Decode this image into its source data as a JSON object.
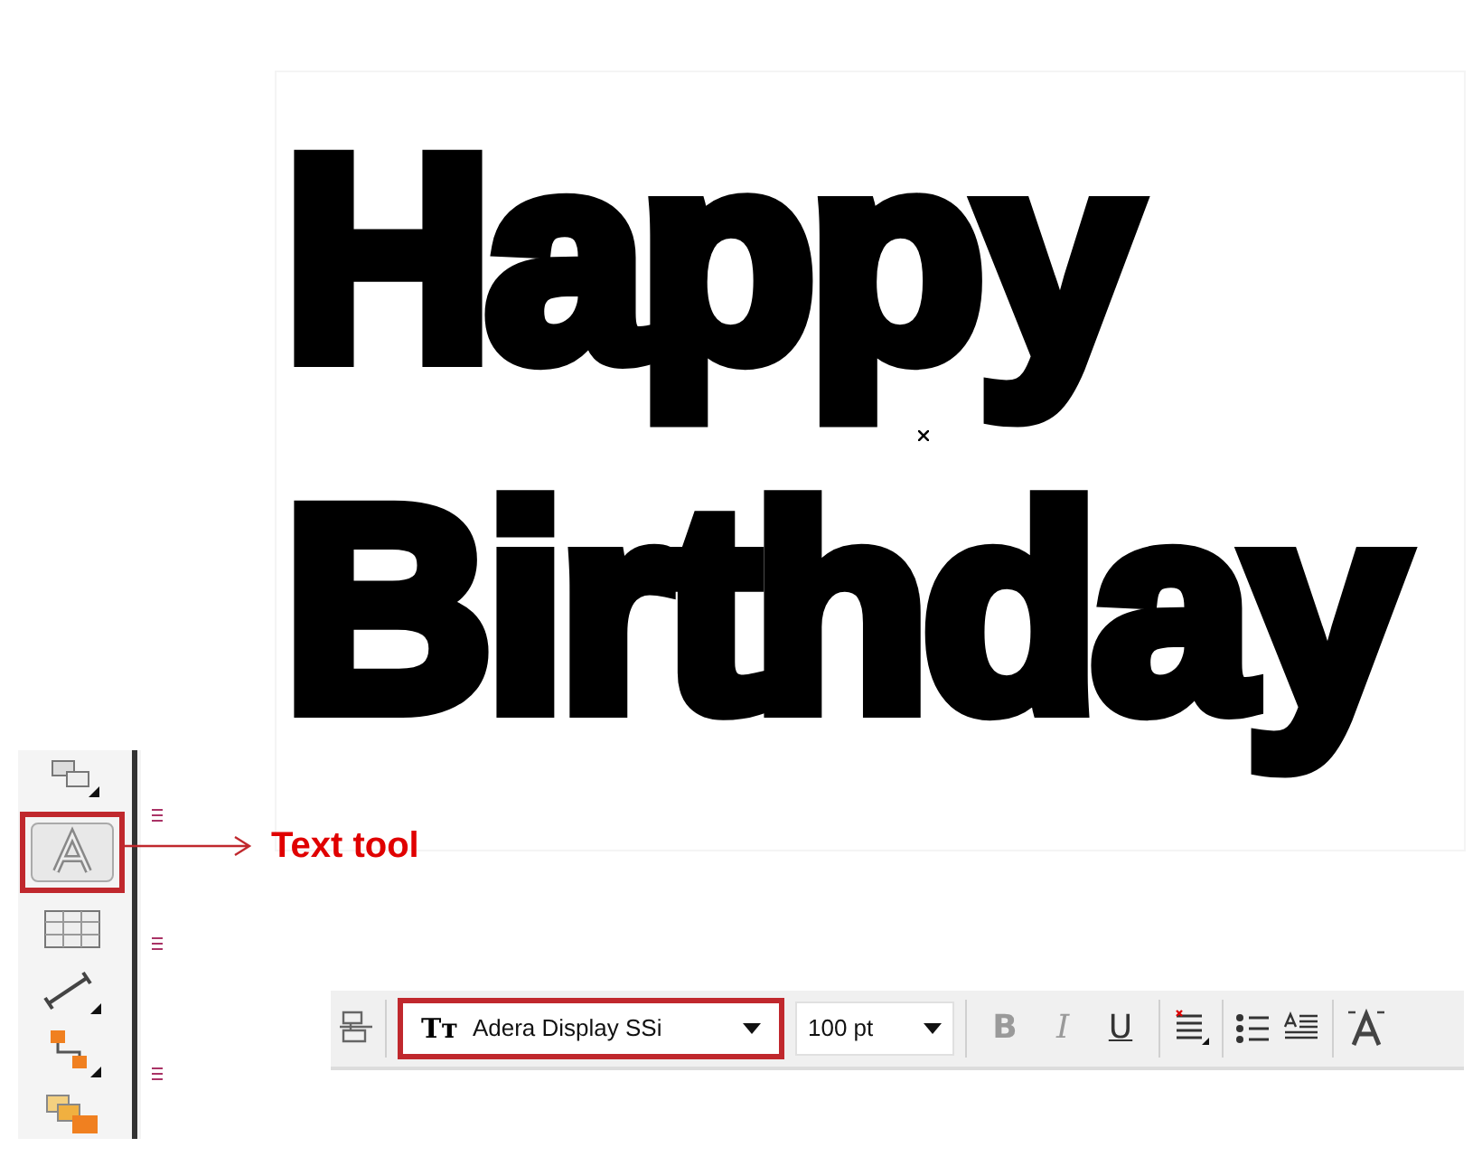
{
  "canvas": {
    "lines": [
      "Happy",
      "Birthday"
    ]
  },
  "toolbox": {
    "tools": [
      {
        "kind": "shapes",
        "selected": false
      },
      {
        "kind": "text",
        "selected": true
      },
      {
        "kind": "table",
        "selected": false
      },
      {
        "kind": "dimension",
        "selected": false
      },
      {
        "kind": "connector",
        "selected": false
      },
      {
        "kind": "blend",
        "selected": false
      }
    ]
  },
  "callout": {
    "label": "Text tool"
  },
  "property_bar": {
    "font": {
      "type_icon": "Tт",
      "value": "Adera Display SSi",
      "highlighted": true
    },
    "size": {
      "value": "100 pt"
    },
    "format_buttons": [
      {
        "label": "B",
        "kind": "bold",
        "disabled": true
      },
      {
        "label": "I",
        "kind": "italic",
        "disabled": true
      },
      {
        "label": "U",
        "kind": "underline",
        "disabled": false
      }
    ]
  }
}
